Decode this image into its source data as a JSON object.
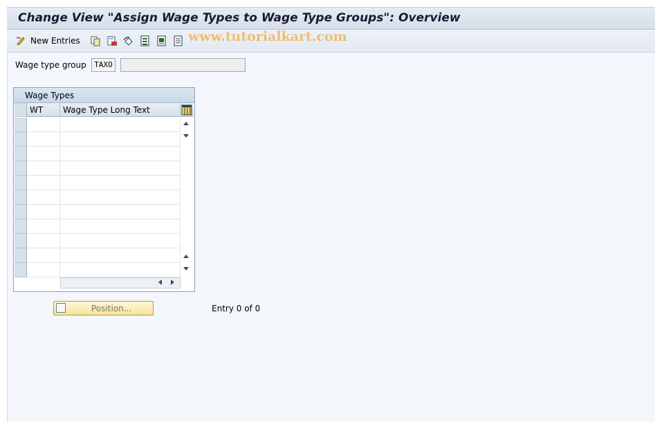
{
  "title": "Change View \"Assign Wage Types to Wage Type Groups\": Overview",
  "toolbar": {
    "new_entries_label": "New Entries",
    "icons": [
      "display-change-icon",
      "copy-as-icon",
      "delete-icon",
      "undo-change-icon",
      "select-all-icon",
      "select-block-icon",
      "deselect-all-icon"
    ]
  },
  "watermark": "www.tutorialkart.com",
  "selection": {
    "label": "Wage type group",
    "value": "TAXO",
    "description": ""
  },
  "table": {
    "title": "Wage Types",
    "columns": [
      "WT",
      "Wage Type Long Text"
    ],
    "rows": [
      [
        "",
        ""
      ],
      [
        "",
        ""
      ],
      [
        "",
        ""
      ],
      [
        "",
        ""
      ],
      [
        "",
        ""
      ],
      [
        "",
        ""
      ],
      [
        "",
        ""
      ],
      [
        "",
        ""
      ],
      [
        "",
        ""
      ],
      [
        "",
        ""
      ],
      [
        "",
        ""
      ]
    ]
  },
  "position_button_label": "Position...",
  "entry_status": "Entry 0 of 0",
  "colors": {
    "title_bg": "#d5dfea",
    "button_bg": "#f3e39b",
    "watermark": "#f0b55a"
  }
}
